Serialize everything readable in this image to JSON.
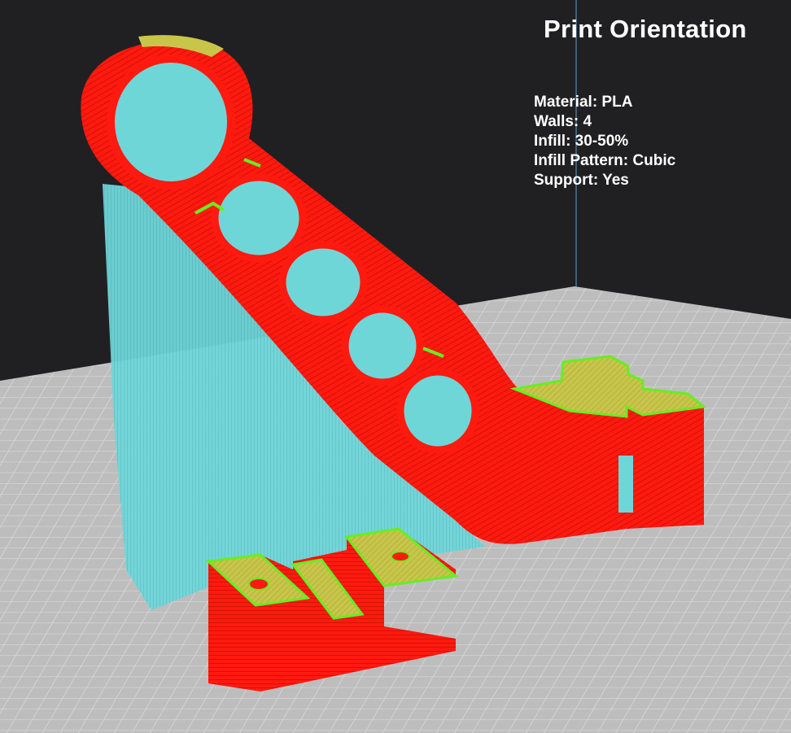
{
  "overlay": {
    "title": "Print Orientation",
    "settings": [
      {
        "label": "Material",
        "value": "PLA"
      },
      {
        "label": "Walls",
        "value": "4"
      },
      {
        "label": "Infill",
        "value": "30-50%"
      },
      {
        "label": "Infill Pattern",
        "value": "Cubic"
      },
      {
        "label": "Support",
        "value": "Yes"
      }
    ]
  },
  "colors": {
    "background": "#202022",
    "build_plate": "#bdbdbd",
    "grid_line": "#d8d8d8",
    "wall": "#ff1a0f",
    "skin": "#c7c64a",
    "infill_edge": "#66ee22",
    "support": "#6fd6d8",
    "axis_line": "#5da0d8"
  }
}
